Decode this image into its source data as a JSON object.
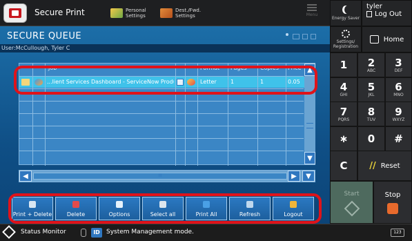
{
  "header": {
    "app_title": "Secure Print",
    "personal_settings_line1": "Personal",
    "personal_settings_line2": "Settings",
    "dest_fwd_line1": "Dest./Fwd.",
    "dest_fwd_line2": "Settings",
    "menu_label": "Menu"
  },
  "right_panel": {
    "energy_saver": "Energy Saver",
    "user_name": "tyler",
    "logout_label": "Log Out",
    "settings_line1": "Settings/",
    "settings_line2": "Registration",
    "home_label": "Home",
    "keys": [
      {
        "d": "1",
        "l": ""
      },
      {
        "d": "2",
        "l": "ABC"
      },
      {
        "d": "3",
        "l": "DEF"
      },
      {
        "d": "4",
        "l": "GHI"
      },
      {
        "d": "5",
        "l": "JKL"
      },
      {
        "d": "6",
        "l": "MNO"
      },
      {
        "d": "7",
        "l": "PQRS"
      },
      {
        "d": "8",
        "l": "TUV"
      },
      {
        "d": "9",
        "l": "WXYZ"
      },
      {
        "d": "∗",
        "l": ""
      },
      {
        "d": "0",
        "l": ""
      },
      {
        "d": "#",
        "l": ""
      }
    ],
    "clear_label": "C",
    "reset_label": "Reset",
    "start_label": "Start",
    "stop_label": "Stop"
  },
  "queue": {
    "title": "SECURE QUEUE",
    "user_line": "User:McCullough, Tyler C",
    "columns": [
      "Job",
      "Format",
      "Pages",
      "Copies",
      "Price"
    ],
    "rows": [
      {
        "job": "...lient Services Dashboard - ServiceNow Production",
        "format": "Letter",
        "pages": "1",
        "copies": "1",
        "price": "0.05"
      }
    ],
    "scroll_thumb_label": "III"
  },
  "actions": [
    {
      "label": "Print + Delete",
      "name": "print-delete-button"
    },
    {
      "label": "Delete",
      "name": "delete-button"
    },
    {
      "label": "Options",
      "name": "options-button"
    },
    {
      "label": "Select all",
      "name": "select-all-button"
    },
    {
      "label": "Print All",
      "name": "print-all-button"
    },
    {
      "label": "Refresh",
      "name": "refresh-button"
    },
    {
      "label": "Logout",
      "name": "logout-button"
    }
  ],
  "status": {
    "status_monitor": "Status Monitor",
    "id_badge": "ID",
    "message": "System Management mode.",
    "counter_label": "123"
  },
  "colors": {
    "highlight_ring": "#e0131a",
    "selected_row": "#3fc2ea",
    "panel_blue": "#0f4f86",
    "start_green": "#4e6a5e",
    "stop_orange": "#e86a2c"
  }
}
